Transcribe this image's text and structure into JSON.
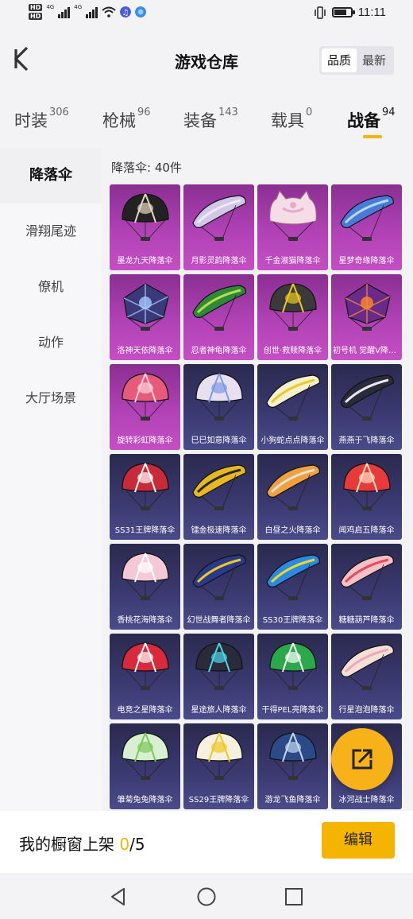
{
  "status_bar": {
    "hd1": "HD",
    "hd2": "HD",
    "net1": "4G",
    "net2": "4G",
    "time": "11:11",
    "battery_level": 0.75
  },
  "header": {
    "title": "游戏仓库",
    "sort_quality": "品质",
    "sort_latest": "最新"
  },
  "tabs": [
    {
      "label": "时装",
      "count": "306"
    },
    {
      "label": "枪械",
      "count": "96"
    },
    {
      "label": "装备",
      "count": "143"
    },
    {
      "label": "载具",
      "count": "0"
    },
    {
      "label": "战备",
      "count": "94"
    }
  ],
  "sidebar": {
    "items": [
      {
        "label": "降落伞"
      },
      {
        "label": "滑翔尾迹"
      },
      {
        "label": "僚机"
      },
      {
        "label": "动作"
      },
      {
        "label": "大厅场景"
      }
    ]
  },
  "main": {
    "count_label": "降落伞: 40件",
    "items": [
      {
        "name": "墨龙九天降落伞",
        "color": "#222",
        "accent": "#e8d8c0",
        "bg": "purple",
        "shape": "round"
      },
      {
        "name": "月影灵韵降落伞",
        "color": "#d0c8e8",
        "accent": "#f0e8ff",
        "bg": "purple",
        "shape": "wing"
      },
      {
        "name": "千金淑猫降落伞",
        "color": "#f5dde8",
        "accent": "#e8a8c8",
        "bg": "purple",
        "shape": "cat"
      },
      {
        "name": "星梦奇缘降落伞",
        "color": "#4a7ad8",
        "accent": "#b8d8ff",
        "bg": "purple",
        "shape": "wing"
      },
      {
        "name": "洛神天依降落伞",
        "color": "#3a3a7a",
        "accent": "#a8c8ff",
        "bg": "purple",
        "shape": "square"
      },
      {
        "name": "忍者神龟降落伞",
        "color": "#2e8a3a",
        "accent": "#b8e048",
        "bg": "purple",
        "shape": "wing"
      },
      {
        "name": "创世·救赎降落伞",
        "color": "#3a3a3a",
        "accent": "#f0c820",
        "bg": "purple",
        "shape": "round"
      },
      {
        "name": "初号机 觉醒V降落伞",
        "color": "#6a2a8a",
        "accent": "#ff8a2a",
        "bg": "purple",
        "shape": "square"
      },
      {
        "name": "旋转彩虹降落伞",
        "color": "#e85a7a",
        "accent": "#ffd0e0",
        "bg": "purple",
        "shape": "round"
      },
      {
        "name": "巳巳如意降落伞",
        "color": "#e8e0f0",
        "accent": "#7a9ae8",
        "bg": "navy",
        "shape": "round"
      },
      {
        "name": "小狗蛇点点降落伞",
        "color": "#f5f0d0",
        "accent": "#f0c820",
        "bg": "navy",
        "shape": "wing"
      },
      {
        "name": "燕燕于飞降落伞",
        "color": "#2a2a3a",
        "accent": "#e8e8f0",
        "bg": "navy",
        "shape": "wing"
      },
      {
        "name": "SS31王牌降落伞",
        "color": "#c82a3a",
        "accent": "#ffffff",
        "bg": "navy",
        "shape": "round"
      },
      {
        "name": "镭金极速降落伞",
        "color": "#e8b820",
        "accent": "#2a2a2a",
        "bg": "navy",
        "shape": "wing"
      },
      {
        "name": "白昼之火降落伞",
        "color": "#f0a040",
        "accent": "#e8e0d0",
        "bg": "navy",
        "shape": "wing"
      },
      {
        "name": "闻鸡启五降落伞",
        "color": "#e83a3a",
        "accent": "#ffe0c0",
        "bg": "navy",
        "shape": "round"
      },
      {
        "name": "香桃花海降落伞",
        "color": "#f5c8d8",
        "accent": "#ffffff",
        "bg": "navy",
        "shape": "round"
      },
      {
        "name": "幻世战舞者降落伞",
        "color": "#2a3a8a",
        "accent": "#f0c820",
        "bg": "navy",
        "shape": "wing"
      },
      {
        "name": "SS30王牌降落伞",
        "color": "#2a8ae8",
        "accent": "#f0d820",
        "bg": "navy",
        "shape": "wing"
      },
      {
        "name": "糖糖葫芦降落伞",
        "color": "#f5c0c8",
        "accent": "#e84a5a",
        "bg": "navy",
        "shape": "wing"
      },
      {
        "name": "电竞之星降落伞",
        "color": "#d82a3a",
        "accent": "#ffffff",
        "bg": "navy",
        "shape": "round"
      },
      {
        "name": "星途旅人降落伞",
        "color": "#2a2a3a",
        "accent": "#48d8e8",
        "bg": "navy",
        "shape": "round"
      },
      {
        "name": "干得PEL亮降落伞",
        "color": "#2aa84a",
        "accent": "#ffffff",
        "bg": "navy",
        "shape": "round"
      },
      {
        "name": "行星泡泡降落伞",
        "color": "#f5e0d8",
        "accent": "#f0a8b8",
        "bg": "navy",
        "shape": "wing"
      },
      {
        "name": "雏菊兔兔降落伞",
        "color": "#d8f0d0",
        "accent": "#7ac85a",
        "bg": "navy",
        "shape": "round"
      },
      {
        "name": "SS29王牌降落伞",
        "color": "#f5f0e0",
        "accent": "#f0c820",
        "bg": "navy",
        "shape": "round"
      },
      {
        "name": "游龙飞鱼降落伞",
        "color": "#2a4a8a",
        "accent": "#c8d8f0",
        "bg": "navy",
        "shape": "round"
      },
      {
        "name": "冰河战士降落伞",
        "color": "#8ac8e8",
        "accent": "#ffffff",
        "bg": "navy",
        "shape": "round"
      }
    ]
  },
  "bottom": {
    "showcase_label": "我的橱窗上架",
    "showcase_current": "0",
    "showcase_total": "/5",
    "edit_label": "编辑"
  },
  "icons": {
    "back": "back-arrow-icon",
    "share": "share-out-icon",
    "nav_back": "nav-back-triangle-icon",
    "nav_home": "nav-home-circle-icon",
    "nav_recent": "nav-recent-square-icon"
  },
  "colors": {
    "accent": "#f5b400",
    "fab": "#f7b21a",
    "card_purple": "#b142b5",
    "card_navy": "#3b3a72"
  }
}
